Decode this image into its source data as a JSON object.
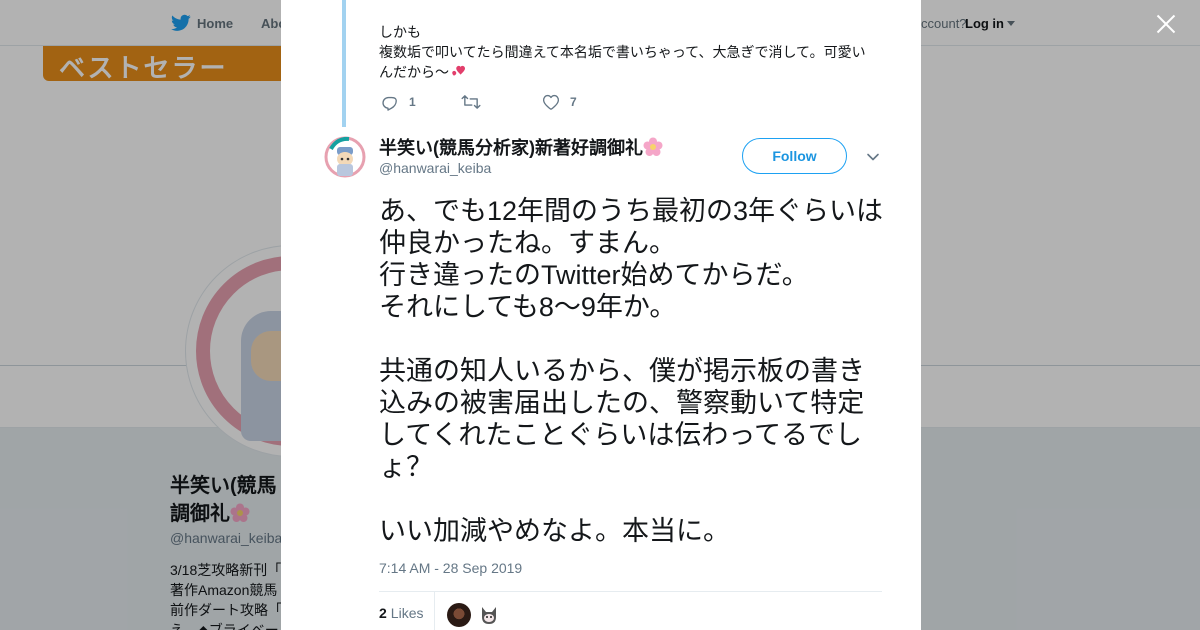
{
  "nav": {
    "home": "Home",
    "about": "Abo",
    "have_account": "ccount?",
    "login": "Log in"
  },
  "profile": {
    "banner_text": "ベストセラー",
    "name_line1": "半笑い(競馬",
    "name_line2": "調御礼",
    "handle": "@hanwarai_keiba",
    "bio_lines": [
      "3/18芝攻略新刊「",
      "著作Amazon競馬",
      "前作ダート攻略「",
      "え。◆ブライベー"
    ]
  },
  "prev_tweet": {
    "line1": "しかも",
    "line2": "複数垢で叩いてたら間違えて本名垢で書いちゃって、大急ぎで消して。可愛いんだから〜",
    "reply_count": "1",
    "retweet_count": "",
    "like_count": "7"
  },
  "tweet": {
    "author_name": "半笑い(競馬分析家)新著好調御礼",
    "author_handle": "@hanwarai_keiba",
    "follow_label": "Follow",
    "text": "あ、でも12年間のうち最初の3年ぐらいは仲良かったね。すまん。\n行き違ったのTwitter始めてからだ。\nそれにしても8〜9年か。\n\n共通の知人いるから、僕が掲示板の書き込みの被害届出したの、警察動いて特定してくれたことぐらいは伝わってるでしょ？\n\nいい加減やめなよ。本当に。",
    "timestamp": "7:14 AM - 28 Sep 2019",
    "likes_count": "2",
    "likes_label": "Likes"
  },
  "colors": {
    "brand_blue": "#1da1f2",
    "thread_line": "#a2d2f0",
    "muted": "#657786"
  },
  "icons": [
    "twitter-bird-icon",
    "reply-icon",
    "retweet-icon",
    "like-icon",
    "chevron-down-icon",
    "close-icon",
    "flower-emoji-icon",
    "heart-emoji-icon"
  ]
}
